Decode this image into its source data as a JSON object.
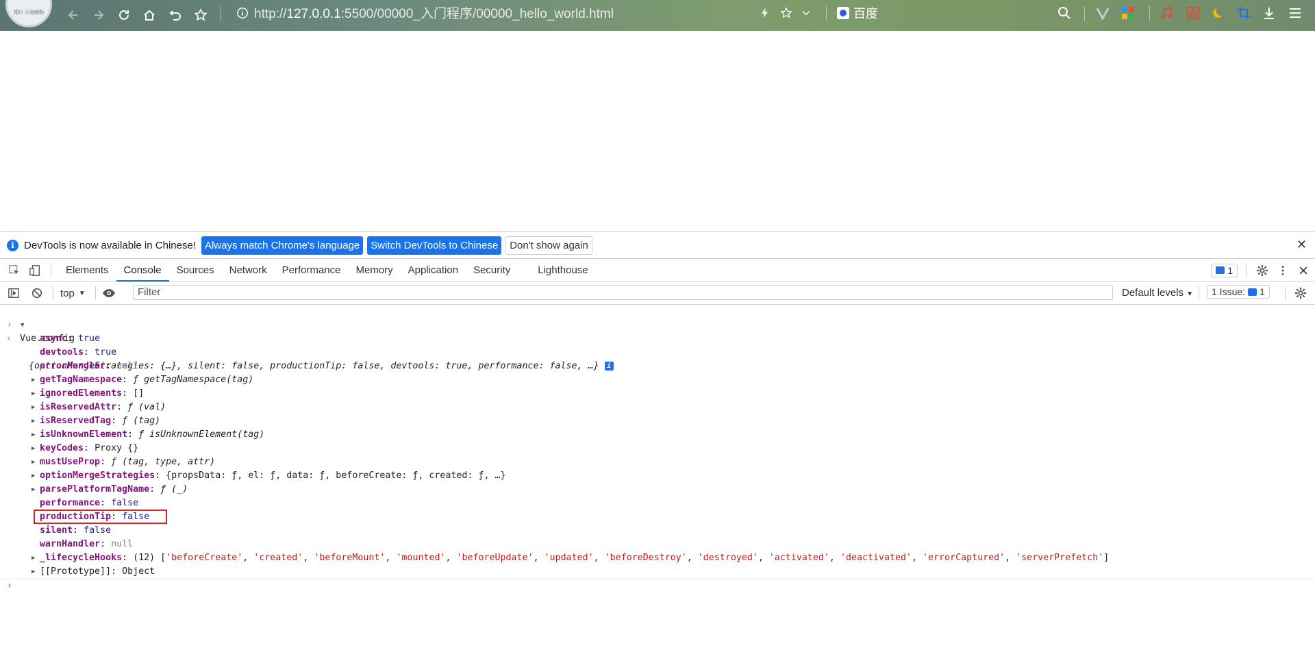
{
  "browser": {
    "avatar_text": "福行 天道酬勤",
    "url_prefix": "http://",
    "url_host": "127.0.0.1",
    "url_rest": ":5500/00000_入门程序/00000_hello_world.html",
    "search_engine": "百度",
    "icons": [
      "back-icon",
      "forward-icon",
      "reload-icon",
      "home-icon",
      "undo-icon",
      "star-icon",
      "info-icon",
      "lightning-icon",
      "star-outline-icon",
      "chevron-down-icon",
      "baidu-icon",
      "search-icon",
      "v-icon",
      "apps-icon",
      "music-icon",
      "pdf-icon",
      "moon-icon",
      "crop-icon",
      "download-icon",
      "menu-icon"
    ]
  },
  "infobar": {
    "message": "DevTools is now available in Chinese!",
    "btn_match": "Always match Chrome's language",
    "btn_switch": "Switch DevTools to Chinese",
    "btn_dont": "Don't show again"
  },
  "tabs": {
    "elements": "Elements",
    "console": "Console",
    "sources": "Sources",
    "network": "Network",
    "performance": "Performance",
    "memory": "Memory",
    "application": "Application",
    "security": "Security",
    "lighthouse": "Lighthouse",
    "msg_count": "1"
  },
  "console_bar": {
    "context": "top",
    "filter_placeholder": "Filter",
    "levels": "Default levels",
    "issues_label": "1 Issue:",
    "issues_count": "1"
  },
  "console": {
    "input": "Vue.config",
    "summary": "{optionMergeStrategies: {…}, silent: false, productionTip: false, devtools: true, performance: false, …}",
    "props": [
      {
        "key": "async",
        "val": "true",
        "type": "bool",
        "expand": false
      },
      {
        "key": "devtools",
        "val": "true",
        "type": "bool",
        "expand": false
      },
      {
        "key": "errorHandler",
        "val": "null",
        "type": "null",
        "expand": false
      },
      {
        "key": "getTagNamespace",
        "val": "ƒ getTagNamespace(tag)",
        "type": "fn",
        "expand": true
      },
      {
        "key": "ignoredElements",
        "val": "[]",
        "type": "plain",
        "expand": true
      },
      {
        "key": "isReservedAttr",
        "val": "ƒ (val)",
        "type": "fn",
        "expand": true
      },
      {
        "key": "isReservedTag",
        "val": "ƒ (tag)",
        "type": "fn",
        "expand": true
      },
      {
        "key": "isUnknownElement",
        "val": "ƒ isUnknownElement(tag)",
        "type": "fn",
        "expand": true
      },
      {
        "key": "keyCodes",
        "val": "Proxy {}",
        "type": "plain",
        "expand": true
      },
      {
        "key": "mustUseProp",
        "val": "ƒ (tag, type, attr)",
        "type": "fn",
        "expand": true
      },
      {
        "key": "optionMergeStrategies",
        "val": "{propsData: ƒ, el: ƒ, data: ƒ, beforeCreate: ƒ, created: ƒ, …}",
        "type": "plain",
        "expand": true
      },
      {
        "key": "parsePlatformTagName",
        "val": "ƒ (_)",
        "type": "fn",
        "expand": true
      },
      {
        "key": "performance",
        "val": "false",
        "type": "bool",
        "expand": false
      },
      {
        "key": "productionTip",
        "val": "false",
        "type": "bool",
        "expand": false,
        "highlight": true
      },
      {
        "key": "silent",
        "val": "false",
        "type": "bool",
        "expand": false
      },
      {
        "key": "warnHandler",
        "val": "null",
        "type": "null",
        "expand": false
      },
      {
        "key": "_lifecycleHooks",
        "val": "(12) ['beforeCreate', 'created', 'beforeMount', 'mounted', 'beforeUpdate', 'updated', 'beforeDestroy', 'destroyed', 'activated', 'deactivated', 'errorCaptured', 'serverPrefetch']",
        "type": "arr",
        "expand": true
      },
      {
        "key": "[[Prototype]]",
        "val": "Object",
        "type": "plain",
        "expand": true,
        "plainkey": true
      }
    ]
  },
  "colors": {
    "accent": "#1a73e8",
    "highlight_border": "#e02020",
    "key": "#881280",
    "string": "#c41a16",
    "bool": "#1a1aa6"
  }
}
